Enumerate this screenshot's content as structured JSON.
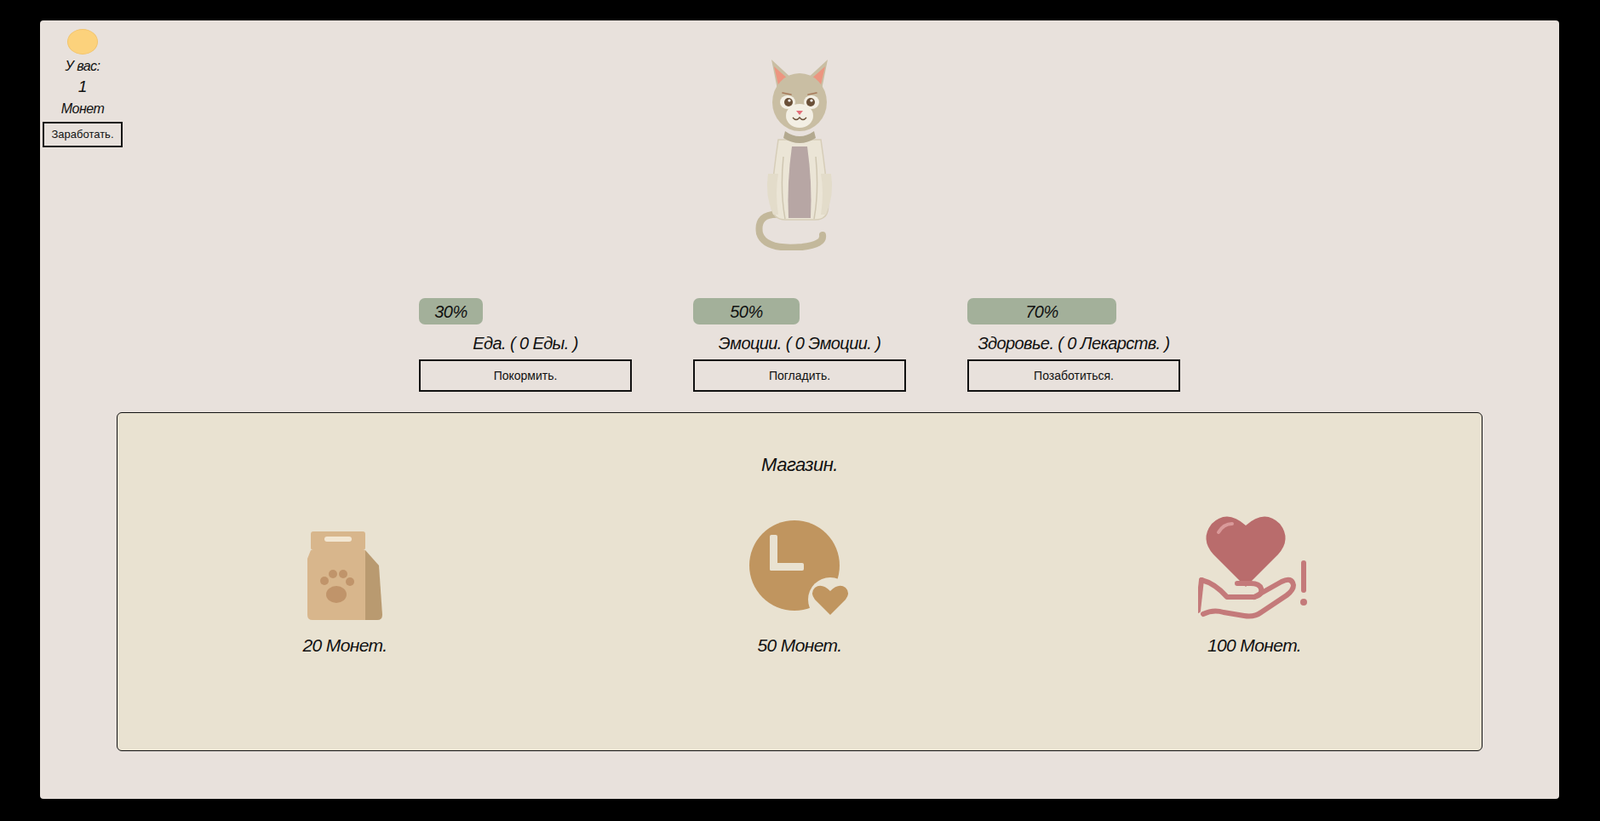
{
  "wallet": {
    "label": "У вас:",
    "amount": "1",
    "unit": "Монет",
    "earn_button": "Заработать."
  },
  "stats": [
    {
      "reading": "30%",
      "level": 0.3,
      "label": "Еда. ( 0 Еды. )",
      "button": "Покормить."
    },
    {
      "reading": "50%",
      "level": 0.5,
      "label": "Эмоции. ( 0 Эмоции. )",
      "button": "Погладить."
    },
    {
      "reading": "70%",
      "level": 0.7,
      "label": "Здоровье. ( 0 Лекарств. )",
      "button": "Позаботиться."
    }
  ],
  "shop": {
    "title": "Магазин.",
    "items": [
      {
        "kind": "food",
        "price": "20 Монет."
      },
      {
        "kind": "emotion",
        "price": "50 Монет."
      },
      {
        "kind": "health",
        "price": "100 Монет."
      }
    ]
  }
}
